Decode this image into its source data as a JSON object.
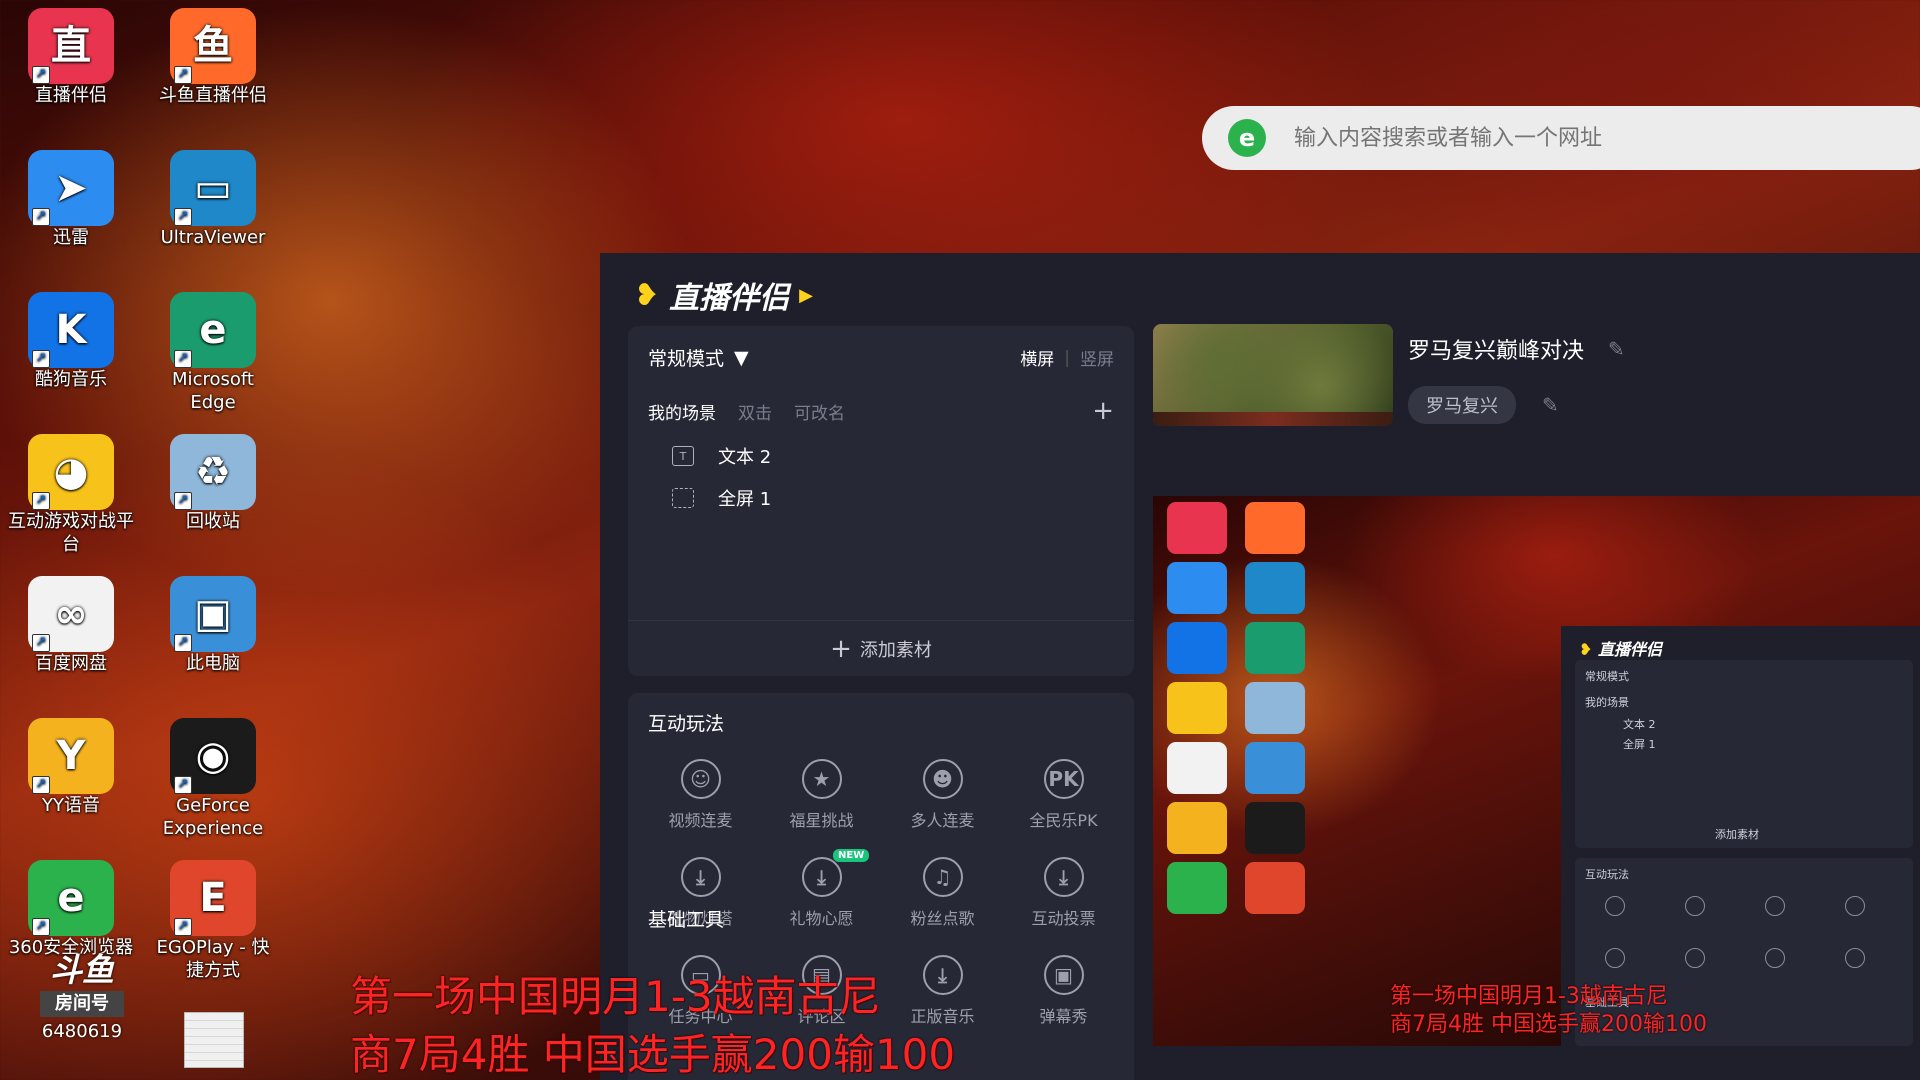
{
  "desktop": {
    "icons": [
      {
        "label": "直播伴侣",
        "glyph": "直",
        "bg": "#e8344e"
      },
      {
        "label": "斗鱼直播伴侣",
        "glyph": "鱼",
        "bg": "#ff6a2a"
      },
      {
        "label": "迅雷",
        "glyph": "➤",
        "bg": "#2d8cf0"
      },
      {
        "label": "UltraViewer",
        "glyph": "▭",
        "bg": "#1e88c8"
      },
      {
        "label": "酷狗音乐",
        "glyph": "K",
        "bg": "#1273e6"
      },
      {
        "label": "Microsoft Edge",
        "glyph": "e",
        "bg": "#1a9c6e"
      },
      {
        "label": "互动游戏对战平台",
        "glyph": "◕",
        "bg": "#f7c21a"
      },
      {
        "label": "回收站",
        "glyph": "♻",
        "bg": "#8fb7d9"
      },
      {
        "label": "百度网盘",
        "glyph": "∞",
        "bg": "#f2f2f2"
      },
      {
        "label": "此电脑",
        "glyph": "▣",
        "bg": "#3a90d8"
      },
      {
        "label": "YY语音",
        "glyph": "Y",
        "bg": "#f5b21f"
      },
      {
        "label": "GeForce Experience",
        "glyph": "◉",
        "bg": "#1b1b1b"
      },
      {
        "label": "360安全浏览器",
        "glyph": "e",
        "bg": "#2bb24c"
      },
      {
        "label": "EGOPlay - 快捷方式",
        "glyph": "E",
        "bg": "#e0462b"
      }
    ],
    "watermark": {
      "logo": "斗鱼",
      "room_label": "房间号",
      "room_number": "6480619"
    }
  },
  "browser": {
    "logo": "e",
    "search_placeholder": "输入内容搜索或者输入一个网址"
  },
  "app": {
    "brand": "直播伴侣",
    "mode": "常规模式",
    "orient_active": "横屏",
    "orient_inactive": "竖屏",
    "scene_title": "我的场景",
    "scene_hint_1": "双击",
    "scene_hint_2": "可改名",
    "scenes": [
      {
        "label": "文本 2",
        "icon": "text-icon"
      },
      {
        "label": "全屏 1",
        "icon": "fullscreen-icon"
      }
    ],
    "add_material": "添加素材",
    "interactive_title": "互动玩法",
    "interactive_tools": [
      {
        "label": "视频连麦",
        "glyph": "☺",
        "icon": "video-link-icon"
      },
      {
        "label": "福星挑战",
        "glyph": "★",
        "icon": "lucky-star-icon"
      },
      {
        "label": "多人连麦",
        "glyph": "☻",
        "icon": "multi-link-icon"
      },
      {
        "label": "全民乐PK",
        "glyph": "PK",
        "icon": "pk-icon"
      },
      {
        "label": "礼物灯塔",
        "glyph": "⤓",
        "icon": "gift-tower-icon"
      },
      {
        "label": "礼物心愿",
        "glyph": "⤓",
        "icon": "gift-wish-icon",
        "badge": "NEW"
      },
      {
        "label": "粉丝点歌",
        "glyph": "♫",
        "icon": "fan-song-icon"
      },
      {
        "label": "互动投票",
        "glyph": "⤓",
        "icon": "vote-icon"
      }
    ],
    "base_tools_title": "基础工具",
    "base_tools": [
      {
        "label": "任务中心",
        "glyph": "▭",
        "icon": "task-icon"
      },
      {
        "label": "评论区",
        "glyph": "▤",
        "icon": "comment-icon"
      },
      {
        "label": "正版音乐",
        "glyph": "⤓",
        "icon": "music-icon"
      },
      {
        "label": "弹幕秀",
        "glyph": "▣",
        "icon": "danmaku-icon"
      }
    ],
    "room_title": "罗马复兴巅峰对决",
    "category_tag": "罗马复兴"
  },
  "overlay_text": {
    "line1": "第一场中国明月1-3越南古尼",
    "line2": "商7局4胜 中国选手赢200输100"
  },
  "preview": {
    "brand": "直播伴侣",
    "mode": "常规模式",
    "scene_title": "我的场景",
    "scene1": "文本 2",
    "scene2": "全屏 1",
    "add_material": "添加素材",
    "interactive_title": "互动玩法",
    "base_tools_title": "基础工具"
  }
}
